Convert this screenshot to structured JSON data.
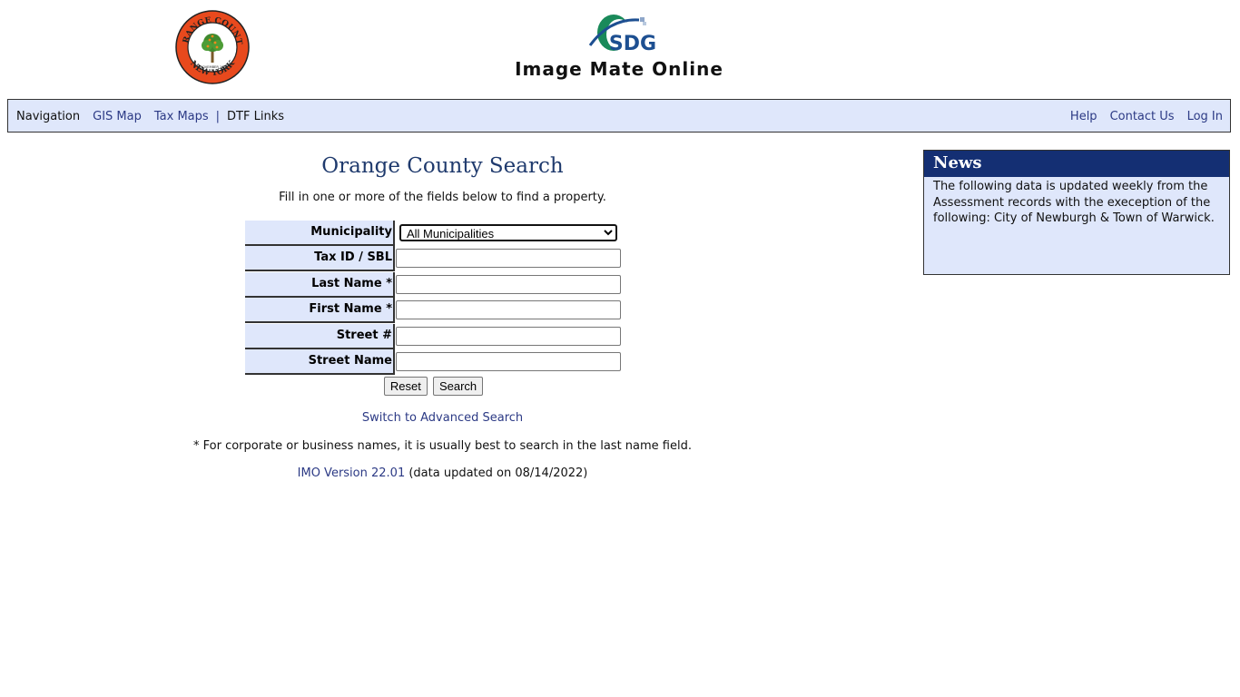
{
  "header": {
    "seal": {
      "top_text": "ORANGE COUNTY",
      "bottom_text": "NEW YORK",
      "date_text": "1 NOVEMBER 1683"
    },
    "logo_text": "SDG",
    "brand_title": "Image Mate Online"
  },
  "nav": {
    "label": "Navigation",
    "left_links": [
      "GIS Map",
      "Tax Maps"
    ],
    "separator": "|",
    "dtf": "DTF Links",
    "right_links": [
      "Help",
      "Contact Us",
      "Log In"
    ]
  },
  "search": {
    "title": "Orange County Search",
    "instructions": "Fill in one or more of the fields below to find a property.",
    "municipality_label": "Municipality",
    "municipality_value": "All Municipalities",
    "fields": [
      {
        "label": "Tax ID / SBL",
        "value": ""
      },
      {
        "label": "Last Name *",
        "value": ""
      },
      {
        "label": "First Name *",
        "value": ""
      },
      {
        "label": "Street #",
        "value": ""
      },
      {
        "label": "Street Name",
        "value": ""
      }
    ],
    "reset_label": "Reset",
    "search_label": "Search",
    "advanced_link": "Switch to Advanced Search",
    "footnote": "* For corporate or business names, it is usually best to search in the last name field.",
    "version_link": "IMO Version 22.01",
    "version_note": " (data updated on 08/14/2022)"
  },
  "news": {
    "title": "News",
    "body": "The following data is updated weekly from the Assessment records with the exeception of the following:  City of Newburgh & Town of Warwick."
  },
  "colors": {
    "panel_bg": "#dfe7fb",
    "link": "#2c3a85",
    "news_header": "#142f73",
    "title": "#1f3a6d",
    "seal_ring": "#e8491d",
    "logo_green": "#1a8a5a",
    "logo_blue": "#1d4f91"
  }
}
